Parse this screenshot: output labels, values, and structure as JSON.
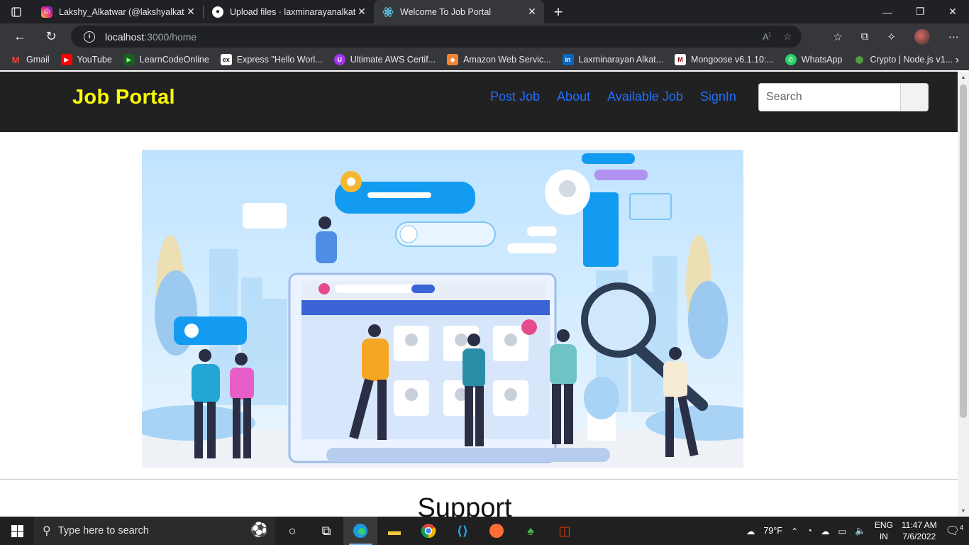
{
  "browser": {
    "tabs": [
      {
        "title": "Lakshy_Alkatwar (@lakshyalkatwa",
        "icon": "instagram-icon",
        "color": "#d6249f",
        "active": false
      },
      {
        "title": "Upload files · laxminarayanalkatw",
        "icon": "github-icon",
        "color": "#24292e",
        "active": false
      },
      {
        "title": "Welcome To Job Portal",
        "icon": "react-icon",
        "color": "#61dafb",
        "active": true
      }
    ],
    "url_host": "localhost",
    "url_path": ":3000/home",
    "bookmarks": [
      {
        "label": "Gmail",
        "icon": "gmail-icon",
        "color": "#ea4335",
        "glyph": "M"
      },
      {
        "label": "YouTube",
        "icon": "youtube-icon",
        "color": "#ff0000",
        "glyph": "▶"
      },
      {
        "label": "LearnCodeOnline",
        "icon": "lco-icon",
        "color": "#1b5e20",
        "glyph": "▶"
      },
      {
        "label": "Express \"Hello Worl...",
        "icon": "express-icon",
        "color": "#555555",
        "glyph": "ex"
      },
      {
        "label": "Ultimate AWS Certif...",
        "icon": "udemy-icon",
        "color": "#a435f0",
        "glyph": "U"
      },
      {
        "label": "Amazon Web Servic...",
        "icon": "aws-icon",
        "color": "#f58536",
        "glyph": "◆"
      },
      {
        "label": "Laxminarayan Alkat...",
        "icon": "linkedin-icon",
        "color": "#0a66c2",
        "glyph": "in"
      },
      {
        "label": "Mongoose v6.1.10:...",
        "icon": "mongoose-icon",
        "color": "#880000",
        "glyph": "M"
      },
      {
        "label": "WhatsApp",
        "icon": "whatsapp-icon",
        "color": "#25d366",
        "glyph": "✆"
      },
      {
        "label": "Crypto | Node.js v1...",
        "icon": "nodejs-icon",
        "color": "#539e43",
        "glyph": "⬢"
      }
    ]
  },
  "site": {
    "brand": "Job Portal",
    "nav_links": [
      "Post Job",
      "About",
      "Available Job",
      "SignIn"
    ],
    "search_placeholder": "Search",
    "section_heading": "Support",
    "colors": {
      "brand": "#ffff00",
      "link": "#1f6fff",
      "navbar": "#212121"
    }
  },
  "taskbar": {
    "search_placeholder": "Type here to search",
    "weather": "79°F",
    "lang_line1": "ENG",
    "lang_line2": "IN",
    "time": "11:47 AM",
    "date": "7/6/2022",
    "notifications": "4"
  }
}
